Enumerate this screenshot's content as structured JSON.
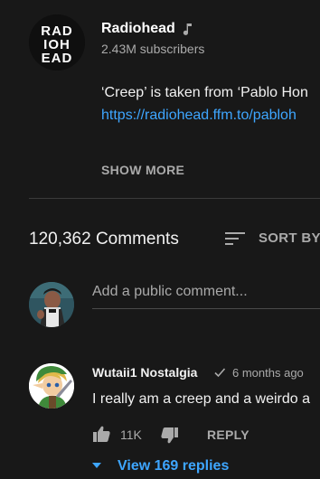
{
  "channel": {
    "name": "Radiohead",
    "subscribers": "2.43M subscribers",
    "logo_text": [
      "RAD",
      "IOH",
      "EAD"
    ]
  },
  "description": {
    "line1": "‘Creep’ is taken from ‘Pablo Hon",
    "link": "https://radiohead.ffm.to/pabloh",
    "show_more": "SHOW MORE"
  },
  "comments_header": {
    "count": "120,362 Comments",
    "sort_label": "SORT BY"
  },
  "add_comment": {
    "placeholder": "Add a public comment..."
  },
  "comment": {
    "author": "Wutaii1 Nostalgia",
    "time": "6 months ago",
    "text": "I really am a creep and a weirdo a",
    "likes": "11K",
    "reply_label": "REPLY",
    "view_replies": "View 169 replies"
  },
  "colors": {
    "background": "#181818",
    "link": "#3ea6ff",
    "muted": "#aaaaaa"
  }
}
